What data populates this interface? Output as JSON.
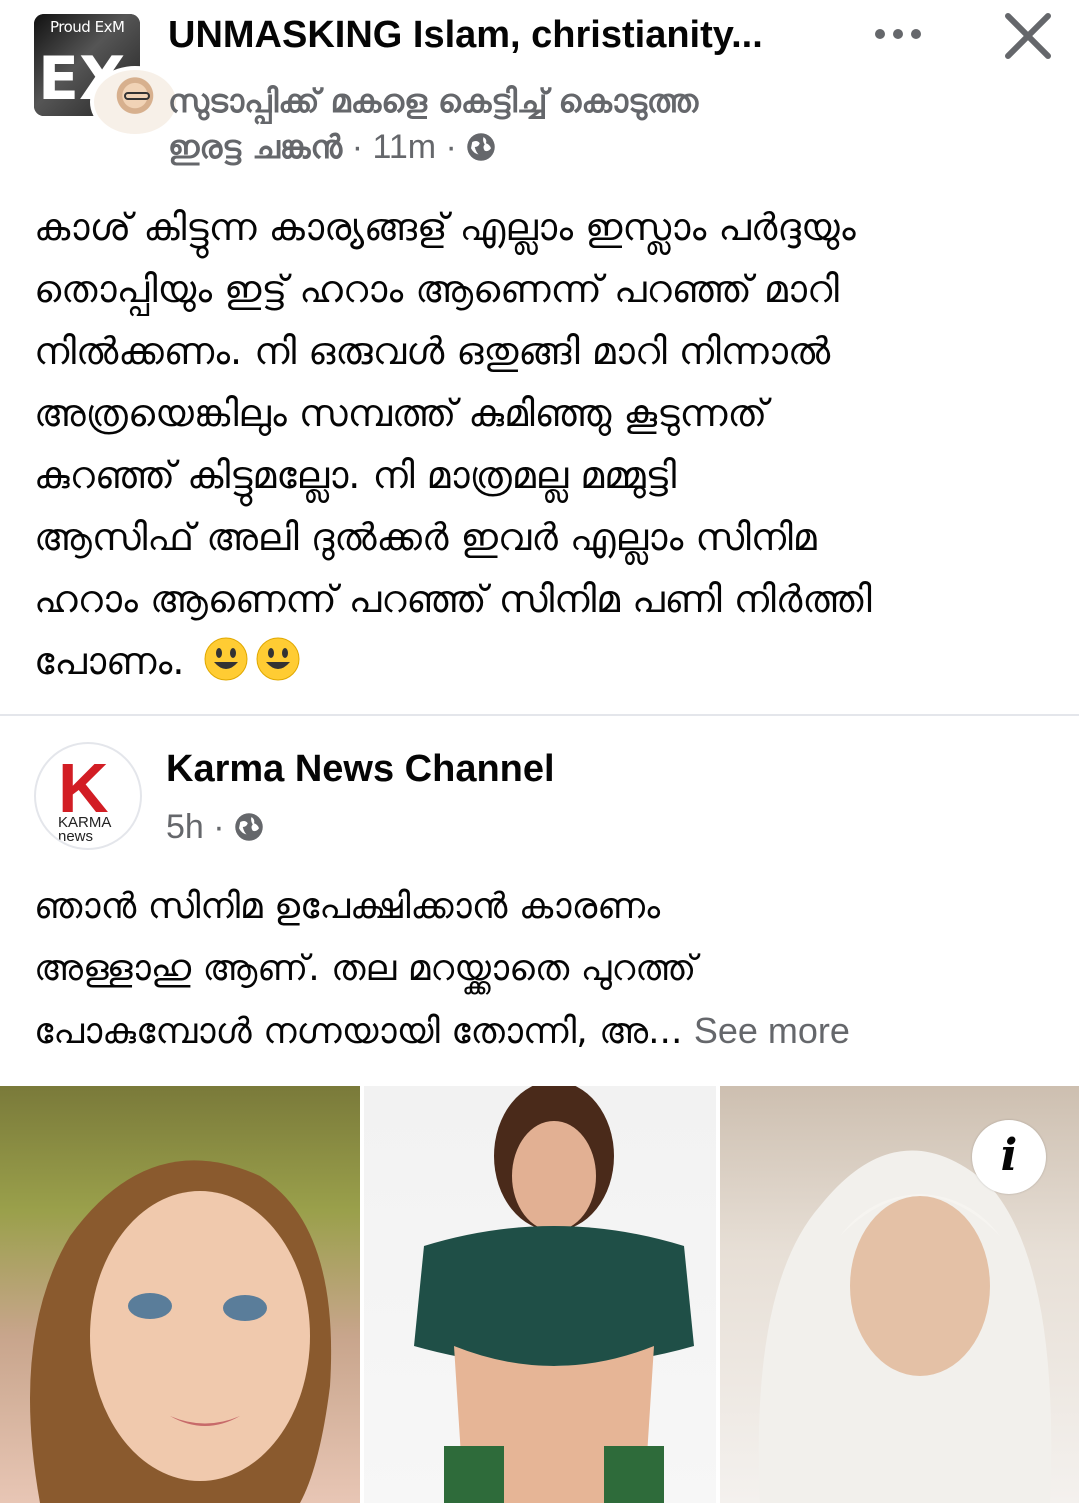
{
  "header": {
    "avatar_badge": "Proud ExM",
    "avatar_letters": "EX",
    "group_name": "UNMASKING Islam, christianity...",
    "author_name": "സുടാപ്പിക്ക് മകളെ കെട്ടിച്ച് കൊടുത്ത ഇരട്ട ചങ്കൻ",
    "timestamp": " · 11m · ",
    "privacy_icon": "globe-icon",
    "more_icon": "more-dots-icon",
    "close_icon": "close-icon"
  },
  "post": {
    "lines": [
      "കാശ് കിട്ടുന്ന കാര്യങ്ങള് എല്ലാം ഇസ്ലാം പർദ്ദയും",
      "തൊപ്പിയും ഇട്ട് ഹറാം ആണെന്ന് പറഞ്ഞ് മാറി",
      "നിൽക്കണം. നി ഒരുവൾ ഒതുങ്ങി മാറി നിന്നാൽ",
      "അത്രയെങ്കിലും സമ്പത്ത് കുമിഞ്ഞു കൂടുന്നത്",
      "കുറഞ്ഞ് കിട്ടുമല്ലോ. നി മാത്രമല്ല മമ്മുട്ടി",
      "ആസിഫ് അലി ദുൽക്കർ ഇവർ എല്ലാം സിനിമ",
      "ഹറാം ആണെന്ന് പറഞ്ഞ് സിനിമ പണി നിർത്തി",
      "പോണം."
    ],
    "emoji": "smiley-emoji"
  },
  "shared": {
    "page_name": "Karma News Channel",
    "logo_letter": "K",
    "logo_sub1": "KARMA",
    "logo_sub2": "news",
    "time": "5h · ",
    "lines": [
      "ഞാൻ സിനിമ ഉപേക്ഷിക്കാൻ കാരണം",
      "അള്ളാഹു ആണ്. തല മറയ്ക്കാതെ പുറത്ത്",
      "പോകുമ്പോൾ നഗ്നയായി തോന്നി, അ... "
    ],
    "see_more": "See more",
    "info_label": "i"
  },
  "colors": {
    "text": "#050505",
    "secondary": "#65676b",
    "divider": "#e4e6eb",
    "karma_red": "#d21d24",
    "emoji_yellow": "#ffcc33"
  }
}
